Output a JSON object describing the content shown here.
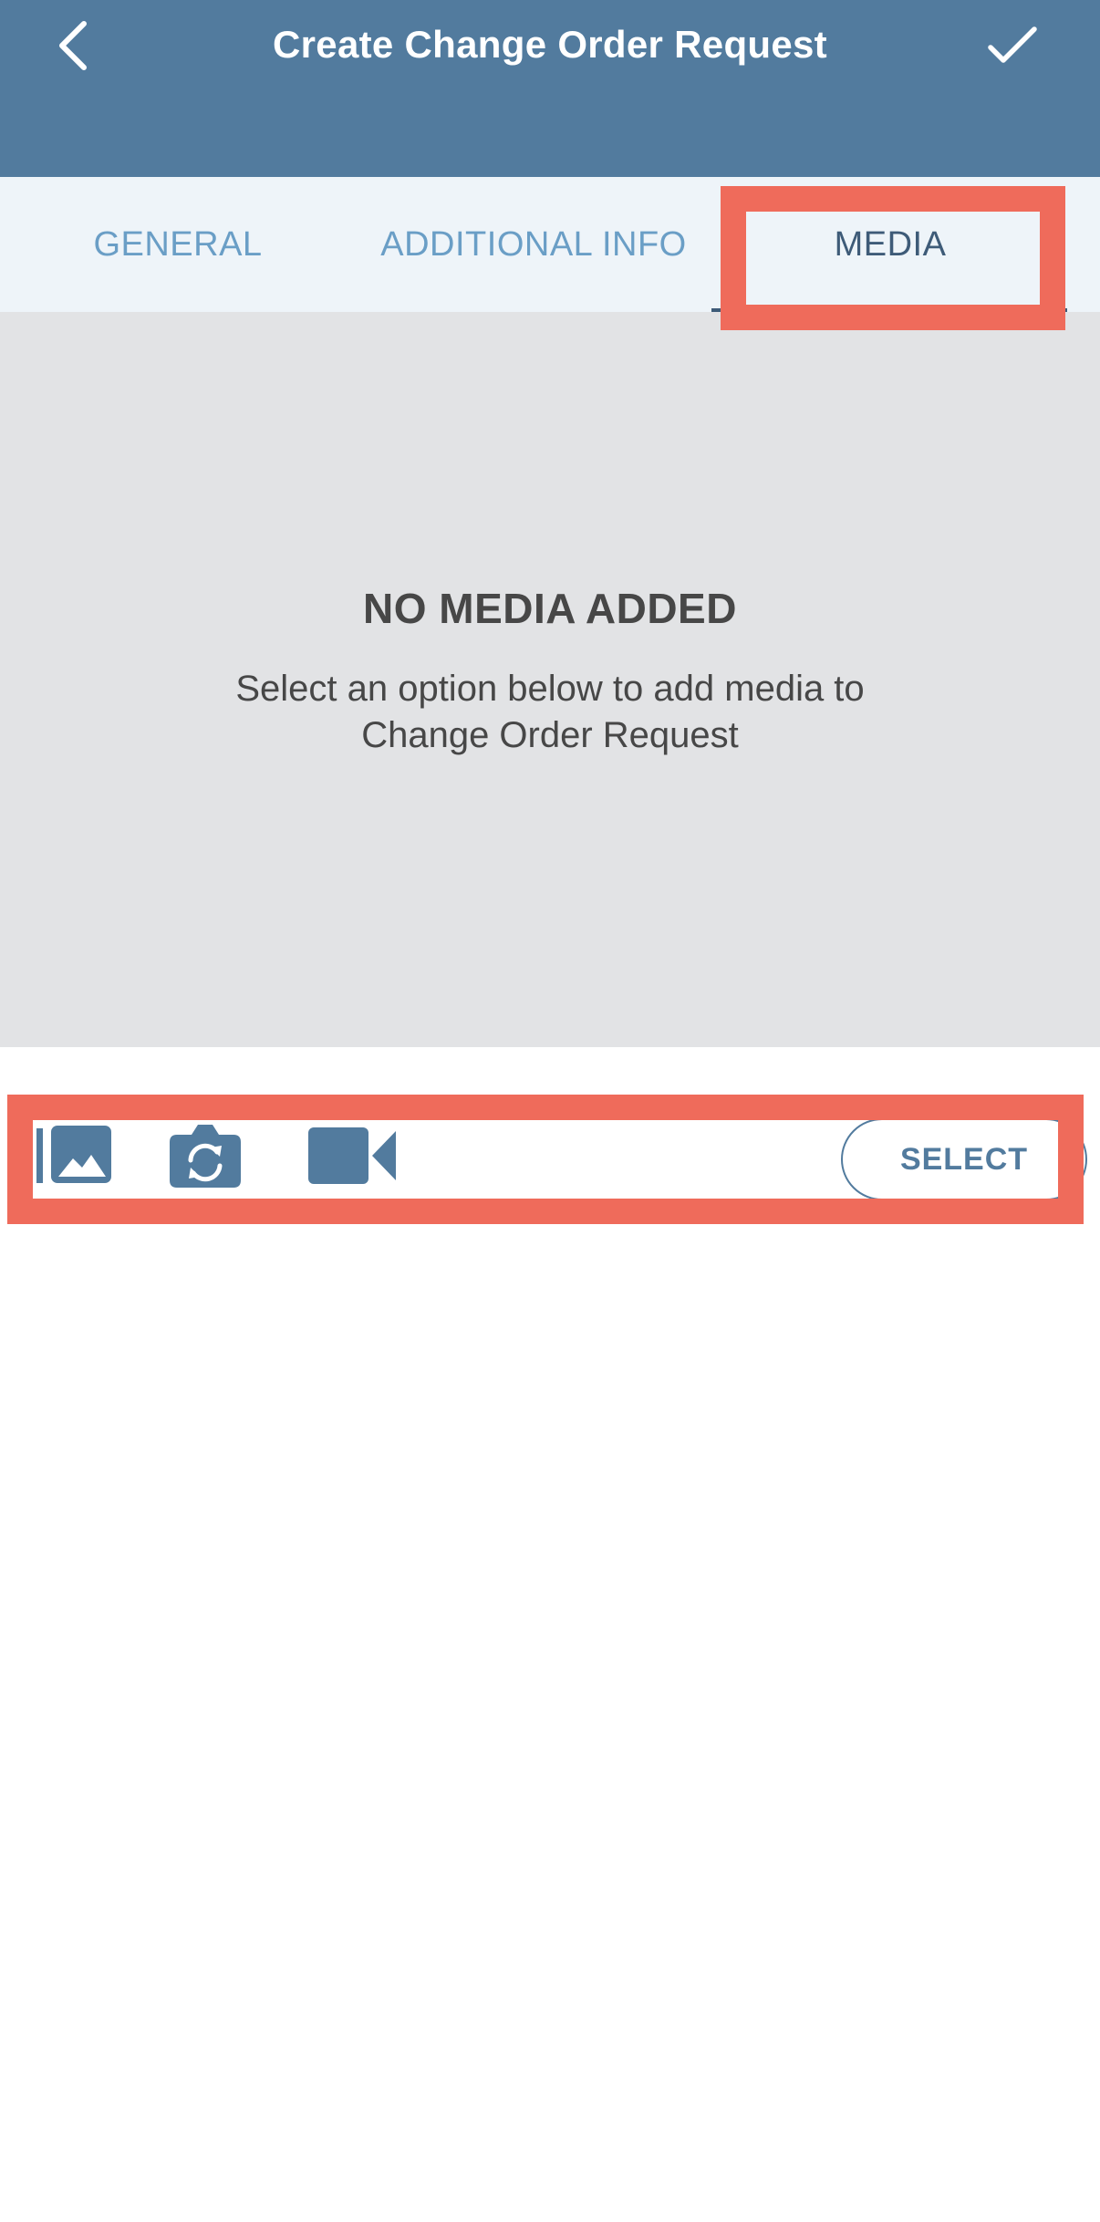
{
  "header": {
    "title": "Create Change Order Request",
    "back_icon": "chevron-left-icon",
    "confirm_icon": "checkmark-icon",
    "background_color": "#527b9e"
  },
  "tabs": [
    {
      "label": "GENERAL",
      "active": false
    },
    {
      "label": "ADDITIONAL INFO",
      "active": false
    },
    {
      "label": "MEDIA",
      "active": true
    }
  ],
  "empty_state": {
    "title": "NO MEDIA ADDED",
    "message": "Select an option below to add media to Change Order Request"
  },
  "media_toolbar": {
    "icons": [
      "photo-gallery-icon",
      "camera-switch-icon",
      "video-camera-icon"
    ],
    "select_label": "SELECT"
  },
  "colors": {
    "accent": "#527b9e",
    "active_tab_text": "#3e5b78",
    "inactive_tab_text": "#6a9ec6",
    "tab_bar_background": "#eef4f9",
    "empty_panel_background": "#e2e3e5",
    "highlight": "#ef6b5b"
  }
}
